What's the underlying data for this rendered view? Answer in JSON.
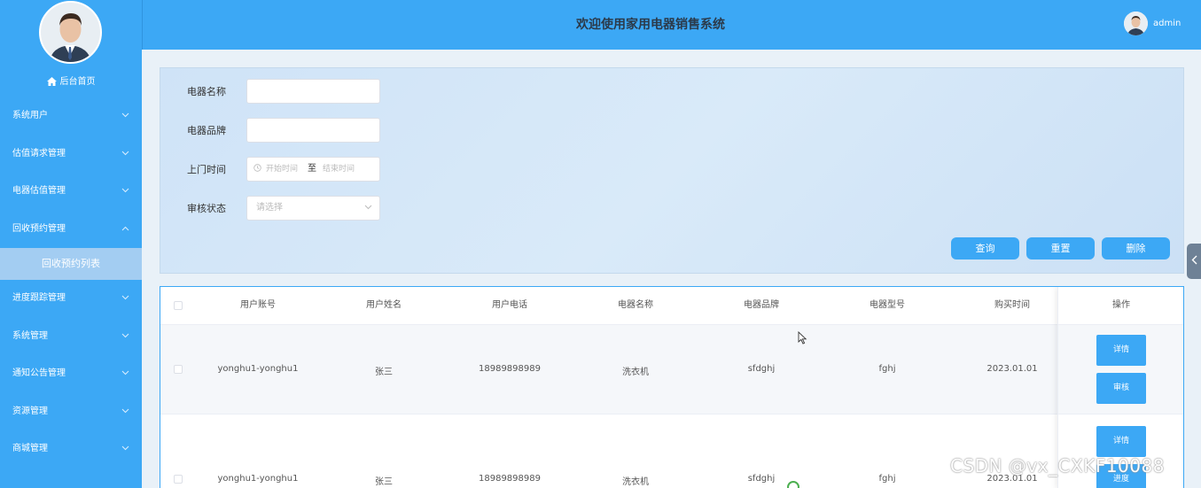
{
  "header": {
    "title": "欢迎使用家用电器销售系统",
    "username": "admin"
  },
  "sidebar": {
    "home": "后台首页",
    "items": [
      {
        "label": "系统用户",
        "expanded": false
      },
      {
        "label": "估值请求管理",
        "expanded": false
      },
      {
        "label": "电器估值管理",
        "expanded": false
      },
      {
        "label": "回收预约管理",
        "expanded": true
      },
      {
        "label": "进度跟踪管理",
        "expanded": false
      },
      {
        "label": "系统管理",
        "expanded": false
      },
      {
        "label": "通知公告管理",
        "expanded": false
      },
      {
        "label": "资源管理",
        "expanded": false
      },
      {
        "label": "商城管理",
        "expanded": false
      }
    ],
    "active_sub": "回收预约列表"
  },
  "search": {
    "name_label": "电器名称",
    "brand_label": "电器品牌",
    "time_label": "上门时间",
    "start_placeholder": "开始时间",
    "range_sep": "至",
    "end_placeholder": "结束时间",
    "status_label": "审核状态",
    "status_placeholder": "请选择",
    "query_btn": "查询",
    "reset_btn": "重置",
    "delete_btn": "删除"
  },
  "table": {
    "headers": [
      "用户账号",
      "用户姓名",
      "用户电话",
      "电器名称",
      "电器品牌",
      "电器型号",
      "购买时间",
      "操作"
    ],
    "rows": [
      {
        "account": "yonghu1-yonghu1",
        "name": "张三",
        "phone": "18989898989",
        "appliance": "洗衣机",
        "brand": "sfdghj",
        "model": "fghj",
        "date": "2023.01.01",
        "btn1": "详情",
        "btn2": "审核"
      },
      {
        "account": "yonghu1-yonghu1",
        "name": "张三",
        "phone": "18989898989",
        "appliance": "洗衣机",
        "brand": "sfdghj",
        "model": "fghj",
        "date": "2023.01.01",
        "btn1": "详情",
        "btn2": "进度"
      }
    ]
  },
  "watermark": "CSDN @vx_CXKF10088",
  "colors": {
    "primary": "#3ca8f5",
    "submenu_active": "#a3cdf2"
  }
}
